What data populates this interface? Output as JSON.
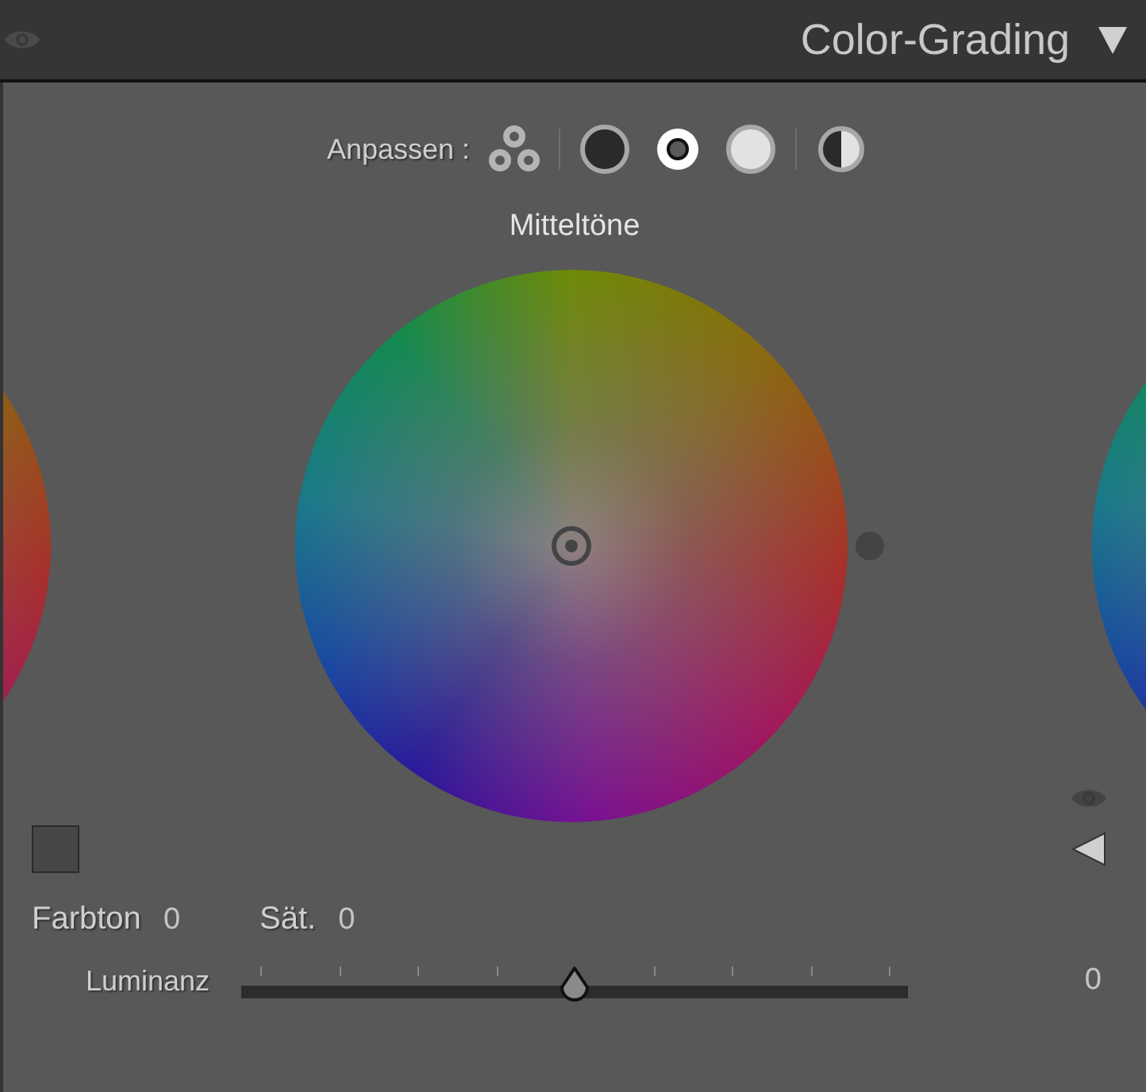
{
  "header": {
    "title": "Color-Grading"
  },
  "adjust": {
    "label": "Anpassen :",
    "modes": [
      {
        "kind": "all",
        "selected": false
      },
      {
        "kind": "shadows",
        "selected": false
      },
      {
        "kind": "midtones",
        "selected": true
      },
      {
        "kind": "highlights",
        "selected": false
      },
      {
        "kind": "global",
        "selected": false
      }
    ]
  },
  "wheel": {
    "title": "Mitteltöne"
  },
  "fields": [
    {
      "label": "Farbton",
      "value": "0"
    },
    {
      "label": "Sät.",
      "value": "0"
    }
  ],
  "luminance": {
    "label": "Luminanz",
    "level": 0.5,
    "value": "0"
  }
}
